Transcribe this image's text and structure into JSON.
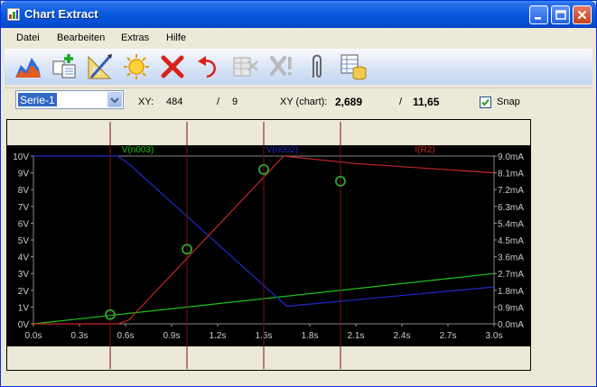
{
  "window": {
    "title": "Chart Extract"
  },
  "colors": {
    "plot_bg": "#000000",
    "green": "#19C319",
    "blue": "#1E2AC8",
    "red": "#C42626",
    "marker": "#2A9A2A",
    "cursor": "#7A1010"
  },
  "menu": {
    "items": [
      {
        "label": "Datei"
      },
      {
        "label": "Bearbeiten"
      },
      {
        "label": "Extras"
      },
      {
        "label": "Hilfe"
      }
    ]
  },
  "toolbar": {
    "icons": [
      "chart-icon",
      "add-table-icon",
      "calibrate-icon",
      "light-icon",
      "delete-icon",
      "undo-icon",
      "grid-disabled-icon",
      "warning-disabled-icon",
      "attach-icon",
      "export-database-icon"
    ]
  },
  "controls": {
    "series_selected": "Serie-1",
    "xy_label": "XY:",
    "xy_x": "484",
    "xy_slash": "/",
    "xy_y": "9",
    "xy_chart_label": "XY (chart):",
    "xy_chart_x": "2,689",
    "xy_chart_slash": "/",
    "xy_chart_y": "11,65",
    "snap_label": "Snap",
    "snap_checked": true
  },
  "chart_data": {
    "type": "line",
    "x_ticks": [
      "0.0s",
      "0.3s",
      "0.6s",
      "0.9s",
      "1.2s",
      "1.5s",
      "1.8s",
      "2.1s",
      "2.4s",
      "2.7s",
      "3.0s"
    ],
    "y_left_ticks": [
      "0V",
      "1V",
      "2V",
      "3V",
      "4V",
      "5V",
      "6V",
      "7V",
      "8V",
      "9V",
      "10V"
    ],
    "y_right_ticks": [
      "0.0mA",
      "0.9mA",
      "1.8mA",
      "2.7mA",
      "3.6mA",
      "4.5mA",
      "5.4mA",
      "6.3mA",
      "7.2mA",
      "8.1mA",
      "9.0mA"
    ],
    "xlim": [
      0,
      3.0
    ],
    "ylim_left": [
      0,
      10
    ],
    "ylim_right": [
      0,
      9.0
    ],
    "grid": true,
    "series": [
      {
        "name": "V(n003)",
        "axis": "left",
        "color": "green",
        "x": [
          0,
          3.0
        ],
        "y": [
          0,
          3.0
        ]
      },
      {
        "name": "V(n002)",
        "axis": "left",
        "color": "blue",
        "x": [
          0,
          0.55,
          0.62,
          1.65,
          3.0
        ],
        "y": [
          10,
          10,
          9.55,
          1.05,
          2.2
        ]
      },
      {
        "name": "I(R2)",
        "axis": "right",
        "color": "red",
        "x": [
          0,
          0.55,
          0.62,
          1.63,
          2.1,
          3.0
        ],
        "y": [
          0,
          0,
          0.2,
          9.0,
          8.6,
          8.1
        ]
      }
    ],
    "cursors_x": [
      0.5,
      1.0,
      1.5,
      2.0
    ],
    "markers": [
      {
        "x": 0.5,
        "y_left": 0.55
      },
      {
        "x": 1.0,
        "y_left": 4.45
      },
      {
        "x": 1.5,
        "y_left": 9.2
      },
      {
        "x": 2.0,
        "y_left": 8.5
      }
    ]
  }
}
